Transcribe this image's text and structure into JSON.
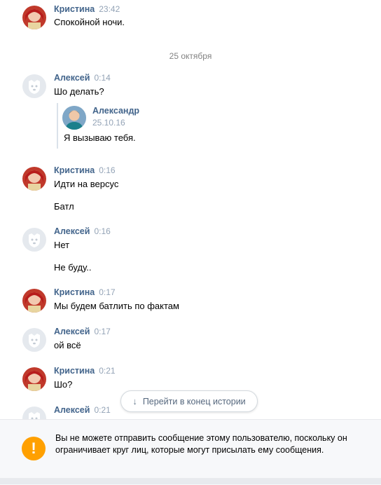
{
  "messages": [
    {
      "author": "Кристина",
      "time": "23:42",
      "lines": [
        "Спокойной ночи."
      ]
    },
    {
      "author": "Алексей",
      "time": "0:14",
      "lines": [
        "Шо делать?"
      ],
      "forwarded": {
        "author": "Александр",
        "date": "25.10.16",
        "text": "Я вызываю тебя."
      }
    },
    {
      "author": "Кристина",
      "time": "0:16",
      "lines": [
        "Идти на версус",
        "Батл"
      ]
    },
    {
      "author": "Алексей",
      "time": "0:16",
      "lines": [
        "Нет",
        "Не буду.."
      ]
    },
    {
      "author": "Кристина",
      "time": "0:17",
      "lines": [
        "Мы будем батлить по фактам"
      ]
    },
    {
      "author": "Алексей",
      "time": "0:17",
      "lines": [
        "ой всё"
      ]
    },
    {
      "author": "Кристина",
      "time": "0:21",
      "lines": [
        "Шо?"
      ]
    },
    {
      "author": "Алексей",
      "time": "0:21",
      "lines": []
    }
  ],
  "date_separator": "25 октября",
  "goto_button": "Перейти в конец истории",
  "notice": "Вы не можете отправить сообщение этому пользователю, поскольку он ограничивает круг лиц, которые могут присылать ему сообщения.",
  "notice_icon": "!",
  "colors": {
    "name": "#42648b",
    "time": "#93a3b6",
    "warning": "#ffa000"
  }
}
